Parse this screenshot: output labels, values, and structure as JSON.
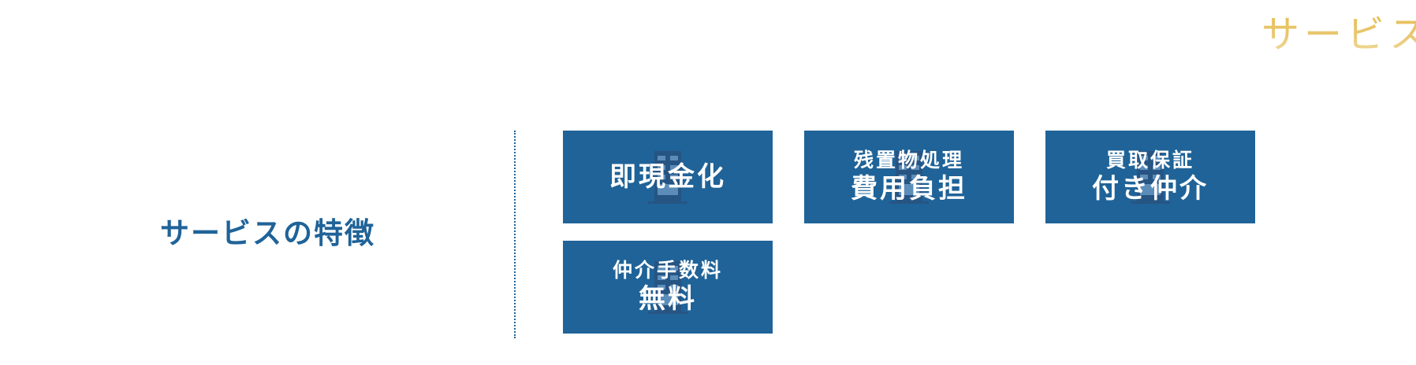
{
  "corner_title": "サービス",
  "heading": "サービスの特徴",
  "colors": {
    "primary": "#1f6398",
    "gold": "#e2b43e",
    "card_text": "#ffffff"
  },
  "cards": [
    {
      "line1": "",
      "line2": "即現金化",
      "icon": "building-icon"
    },
    {
      "line1": "残置物処理",
      "line2": "費用負担",
      "icon": "building-icon"
    },
    {
      "line1": "買取保証",
      "line2": "付き仲介",
      "icon": "building-icon"
    },
    {
      "line1": "仲介手数料",
      "line2": "無料",
      "icon": "building-icon"
    }
  ]
}
